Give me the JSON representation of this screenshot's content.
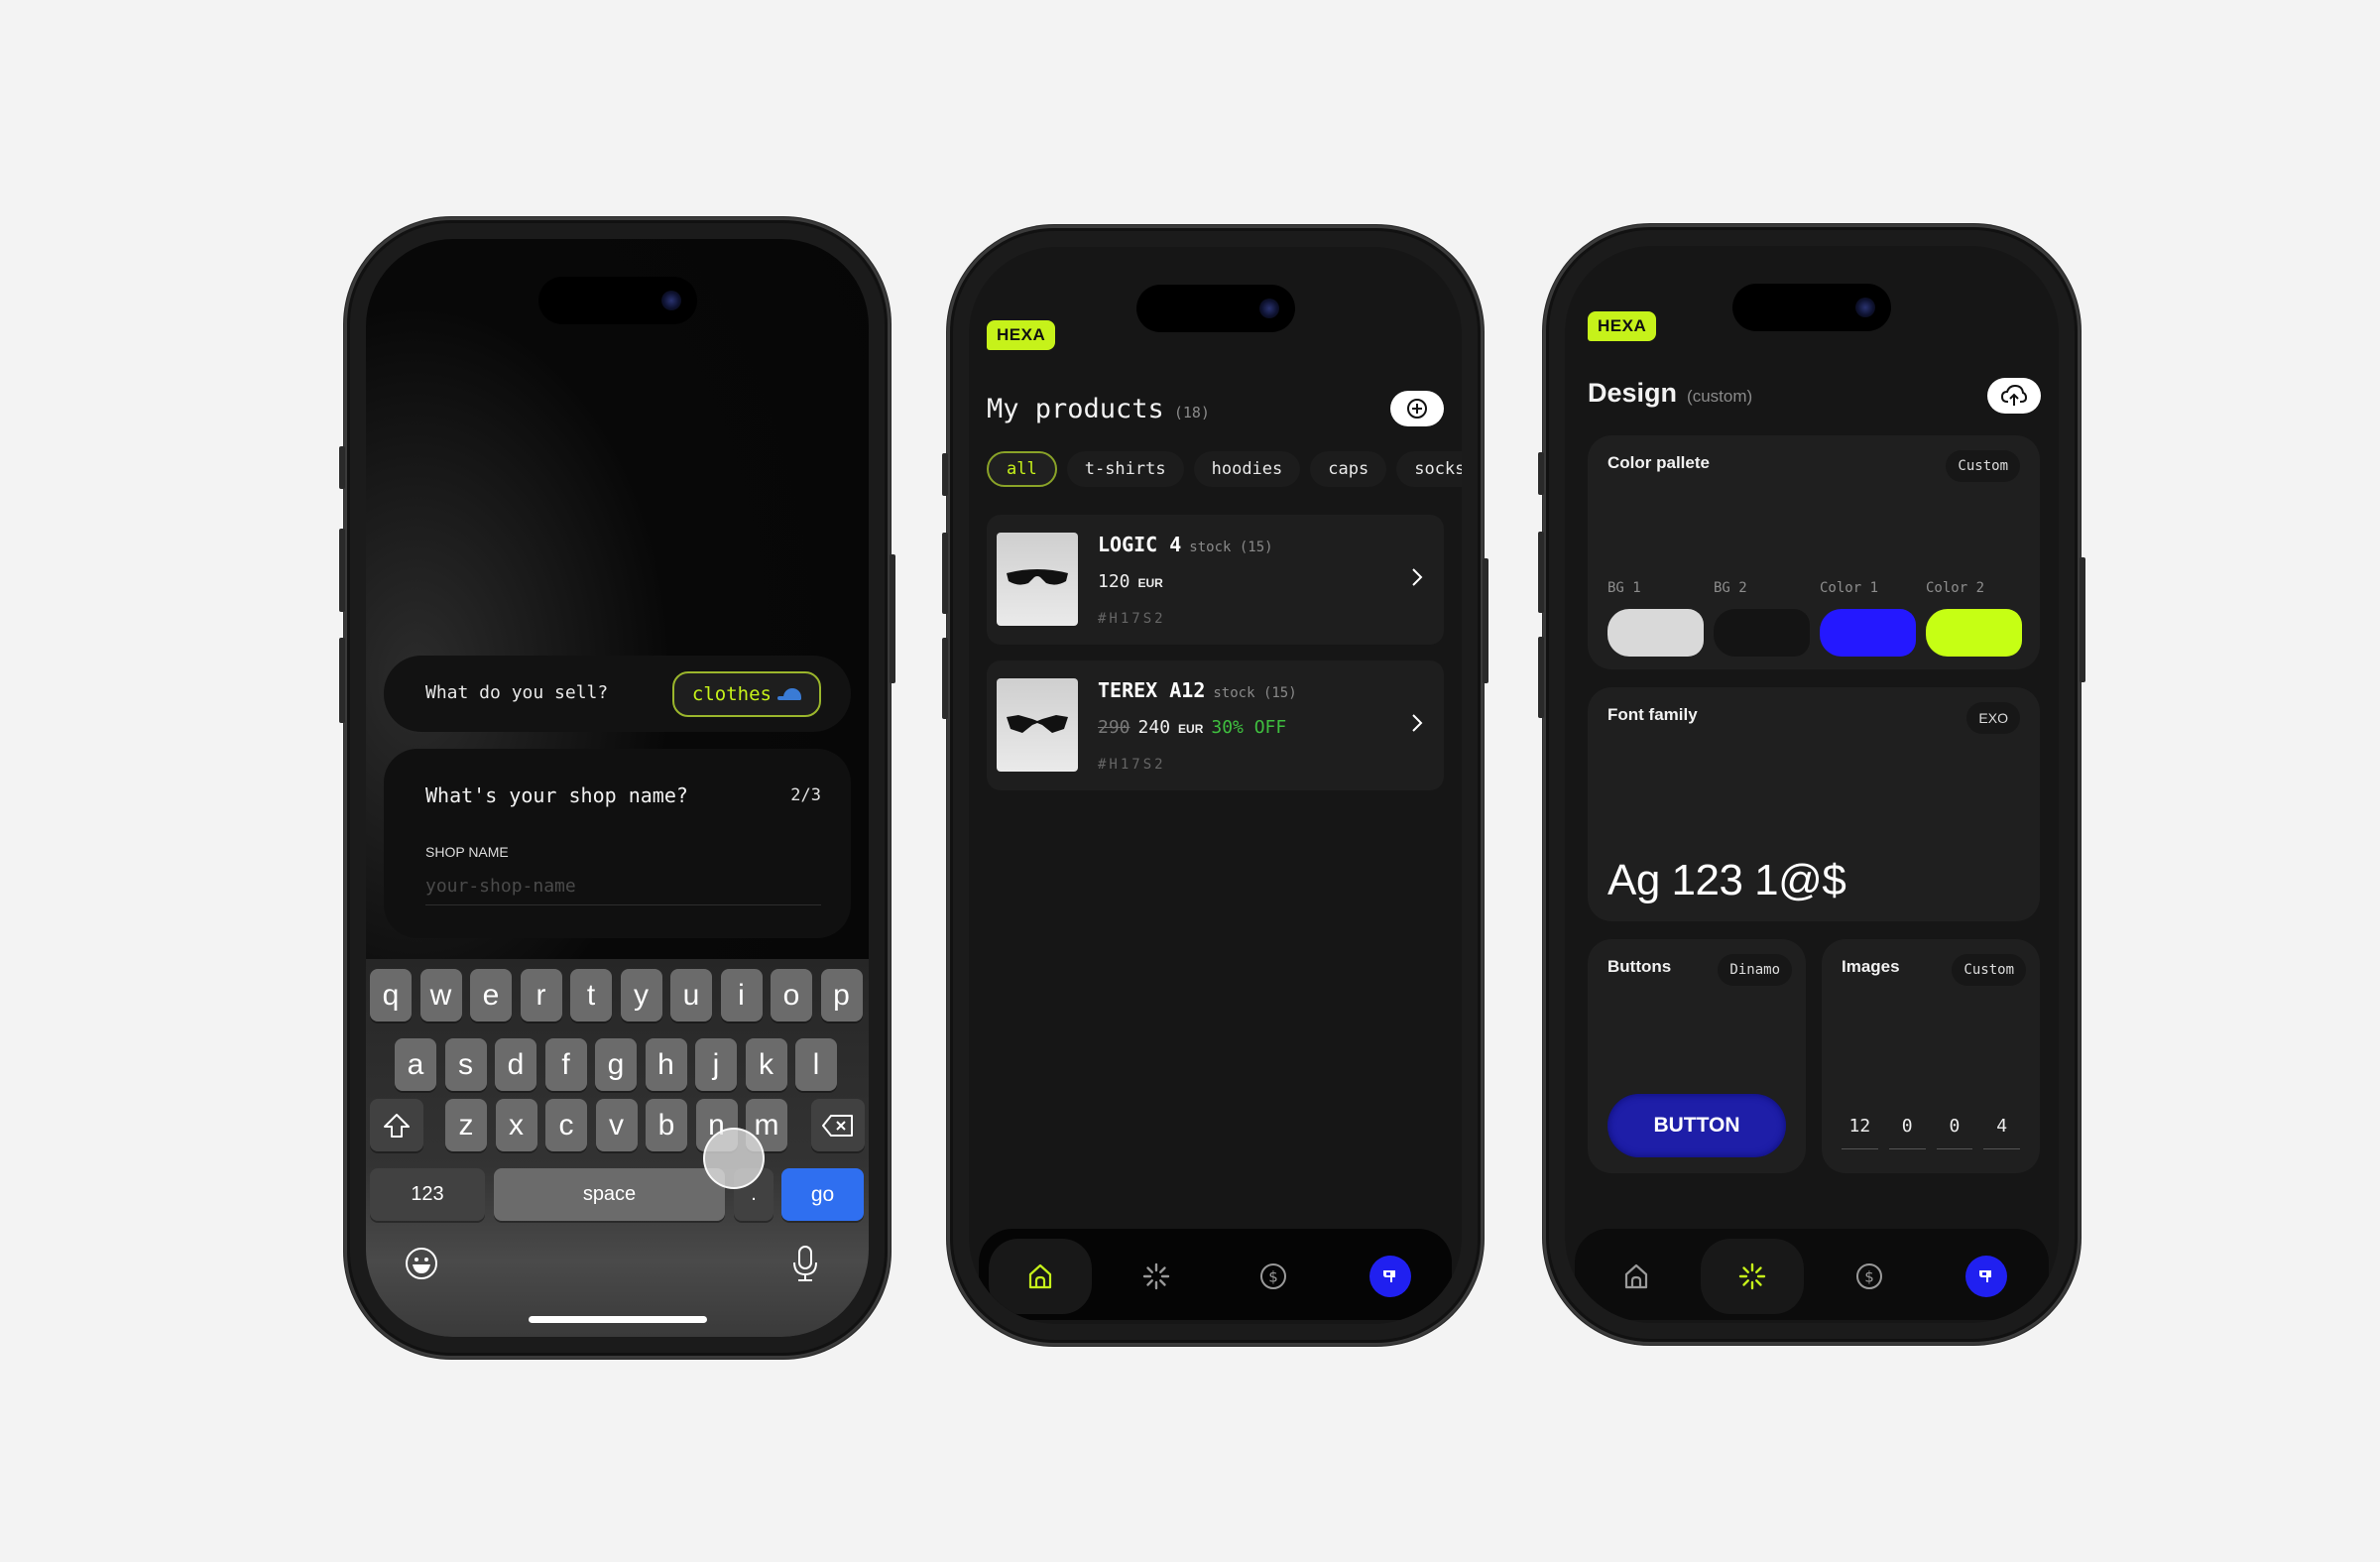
{
  "onboarding": {
    "sell_question": "What do you sell?",
    "sell_answer": "clothes",
    "sell_answer_icon": "cap-icon",
    "shop_question": "What's your shop name?",
    "step": "2/3",
    "field_label": "SHOP NAME",
    "field_placeholder": "your-shop-name",
    "field_value": "",
    "keyboard": {
      "row1": [
        "q",
        "w",
        "e",
        "r",
        "t",
        "y",
        "u",
        "i",
        "o",
        "p"
      ],
      "row2": [
        "a",
        "s",
        "d",
        "f",
        "g",
        "h",
        "j",
        "k",
        "l"
      ],
      "row3": [
        "z",
        "x",
        "c",
        "v",
        "b",
        "n",
        "m"
      ],
      "shift_icon": "shift-icon",
      "delete_icon": "backspace-icon",
      "numbers_label": "123",
      "space_label": "space",
      "period_label": ".",
      "go_label": "go",
      "emoji_icon": "emoji-icon",
      "mic_icon": "microphone-icon"
    }
  },
  "products": {
    "brand": "HEXA",
    "title": "My products",
    "count": "(18)",
    "add_icon": "plus-circle-icon",
    "filters": [
      {
        "label": "all",
        "active": true
      },
      {
        "label": "t-shirts",
        "active": false
      },
      {
        "label": "hoodies",
        "active": false
      },
      {
        "label": "caps",
        "active": false
      },
      {
        "label": "socks",
        "active": false
      }
    ],
    "items": [
      {
        "name": "LOGIC 4",
        "stock": "stock (15)",
        "old_price": "",
        "price": "120",
        "currency": "EUR",
        "discount": "",
        "sku": "#H17S2"
      },
      {
        "name": "TEREX A12",
        "stock": "stock (15)",
        "old_price": "290",
        "price": "240",
        "currency": "EUR",
        "discount": "30% OFF",
        "sku": "#H17S2"
      }
    ],
    "nav": [
      {
        "icon": "home-icon",
        "active": true
      },
      {
        "icon": "sparkle-icon",
        "active": false
      },
      {
        "icon": "dollar-icon",
        "active": false
      },
      {
        "icon": "store-avatar-icon",
        "active": false
      }
    ]
  },
  "design": {
    "brand": "HEXA",
    "title": "Design",
    "subtitle": "(custom)",
    "upload_icon": "cloud-upload-icon",
    "palette": {
      "title": "Color pallete",
      "tag": "Custom",
      "swatches": [
        {
          "label": "BG 1",
          "color": "#d9d9d9"
        },
        {
          "label": "BG 2",
          "color": "#141414"
        },
        {
          "label": "Color 1",
          "color": "#2418ff"
        },
        {
          "label": "Color 2",
          "color": "#c6ff14"
        }
      ]
    },
    "font": {
      "title": "Font family",
      "tag": "EXO",
      "sample": "Ag 123 1@$"
    },
    "buttons": {
      "title": "Buttons",
      "tag": "Dinamo",
      "sample_label": "BUTTON"
    },
    "images": {
      "title": "Images",
      "tag": "Custom",
      "radii": [
        "12",
        "0",
        "0",
        "4"
      ]
    },
    "nav": [
      {
        "icon": "home-icon",
        "active": false
      },
      {
        "icon": "sparkle-icon",
        "active": true
      },
      {
        "icon": "dollar-icon",
        "active": false
      },
      {
        "icon": "store-avatar-icon",
        "active": false
      }
    ]
  },
  "colors": {
    "accent_lime": "#c6f21a",
    "accent_blue": "#2020f0",
    "discount_green": "#3fbf3f",
    "keyboard_go": "#2f6ff0"
  }
}
